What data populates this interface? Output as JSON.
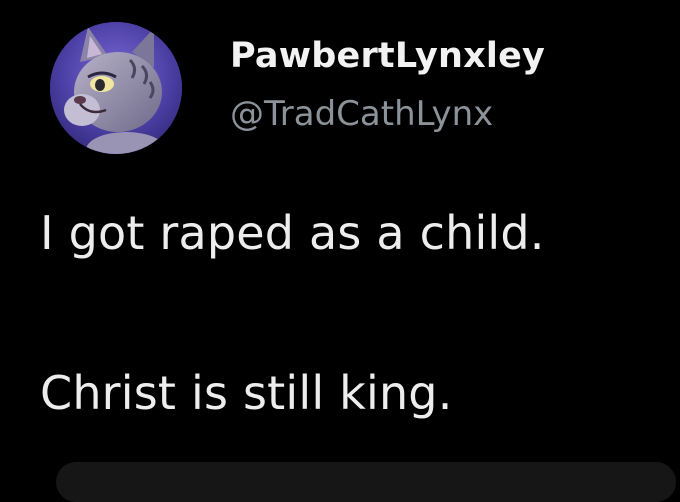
{
  "author": {
    "display_name": "PawbertLynxley",
    "handle": "@TradCathLynx",
    "avatar_icon": "lynx-avatar-icon"
  },
  "tweet": {
    "line_1": "I got raped as a child.",
    "line_2": "Christ is still king."
  },
  "colors": {
    "background": "#000000",
    "primary_text": "#e7e9ea",
    "secondary_text": "#8b9299",
    "avatar_bg": "#4a3f9a"
  }
}
